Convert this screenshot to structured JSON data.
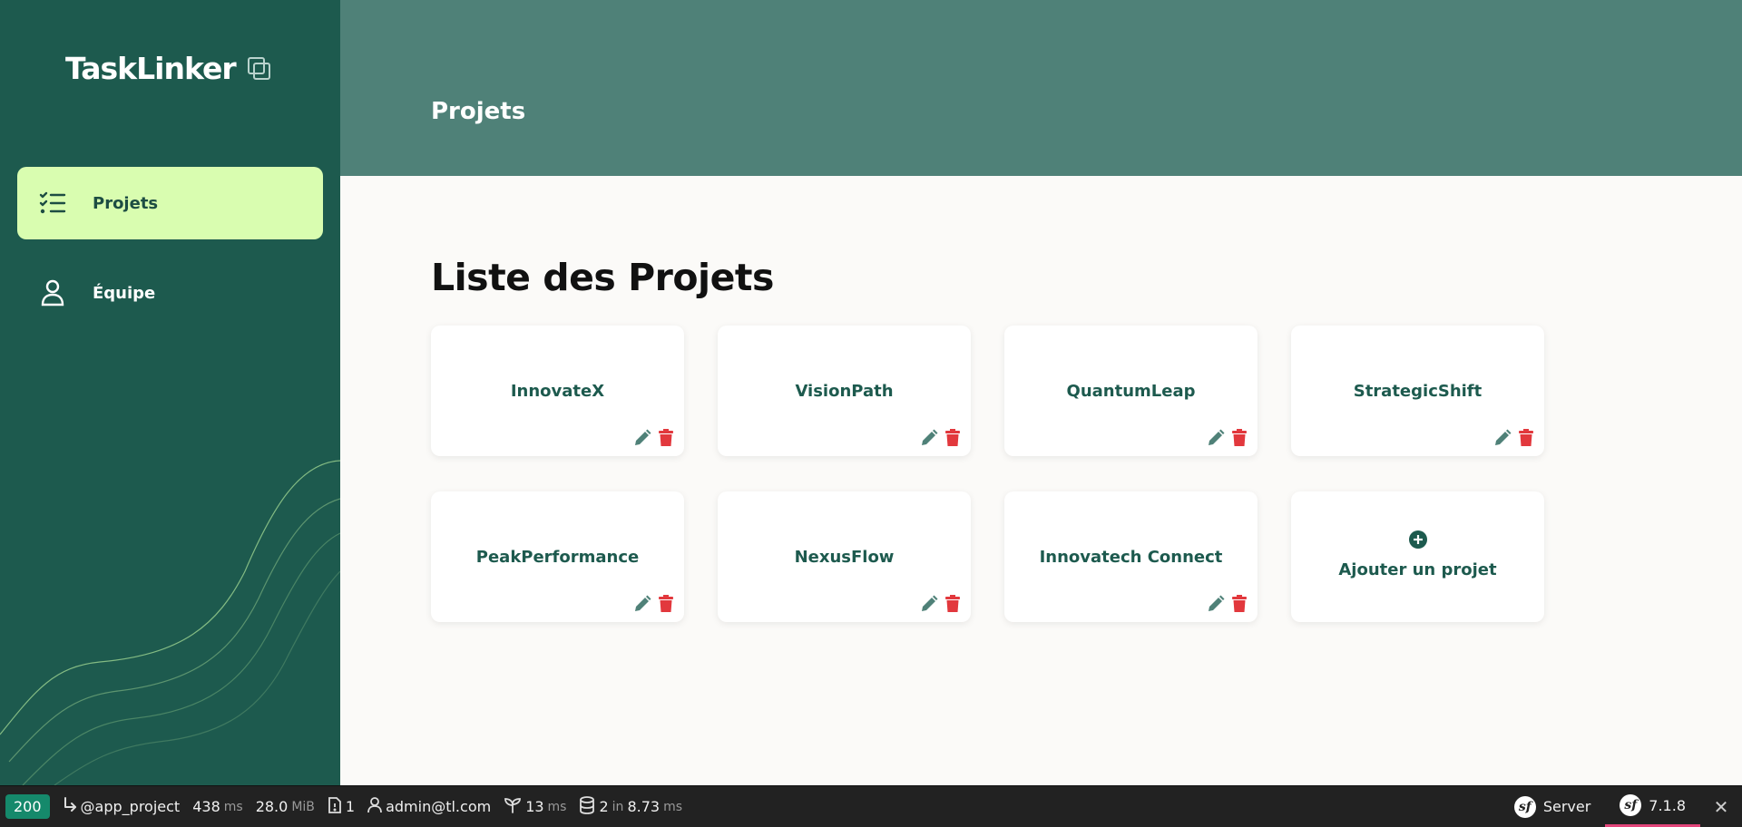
{
  "app": {
    "logo_text": "TaskLinker"
  },
  "sidebar": {
    "items": [
      {
        "label": "Projets",
        "icon": "checklist-icon",
        "active": true
      },
      {
        "label": "Équipe",
        "icon": "user-icon",
        "active": false
      }
    ]
  },
  "header": {
    "title": "Projets"
  },
  "main": {
    "title": "Liste des Projets",
    "projects": [
      {
        "name": "InnovateX"
      },
      {
        "name": "VisionPath"
      },
      {
        "name": "QuantumLeap"
      },
      {
        "name": "StrategicShift"
      },
      {
        "name": "PeakPerformance"
      },
      {
        "name": "NexusFlow"
      },
      {
        "name": "Innovatech Connect"
      }
    ],
    "add_label": "Ajouter un projet"
  },
  "toolbar": {
    "status": "200",
    "route": "@app_project",
    "time_value": "438",
    "time_unit": "ms",
    "memory_value": "28.0",
    "memory_unit": "MiB",
    "logs_count": "1",
    "user": "admin@tl.com",
    "twig_value": "13",
    "twig_unit": "ms",
    "db_queries": "2",
    "db_in": "in",
    "db_time": "8.73",
    "db_unit": "ms",
    "server_label": "Server",
    "version": "7.1.8"
  },
  "colors": {
    "sidebar_bg": "#1d5a4e",
    "header_bg": "#4f8178",
    "active_nav_bg": "#d9fdb0",
    "edit_icon": "#4f8178",
    "delete_icon": "#e2383d"
  }
}
